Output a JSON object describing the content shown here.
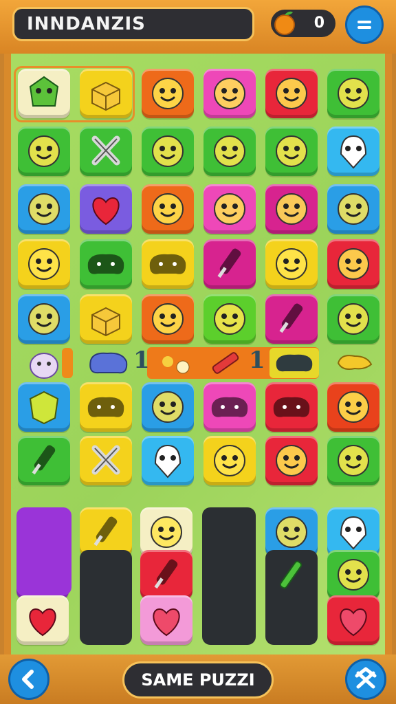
{
  "header": {
    "title": "INNDANZIS",
    "score": "0"
  },
  "footer": {
    "button_label": "SAME PUZZI"
  },
  "strip": {
    "num_left": "1",
    "num_right": "1"
  },
  "colors": {
    "accent": "#e88d2a",
    "board": "#a8dc62",
    "button_blue": "#1e8fe0"
  },
  "tiles": [
    {
      "row": 0,
      "col": 0,
      "color": "cream",
      "icon": "green-gem-icon"
    },
    {
      "row": 0,
      "col": 1,
      "color": "yellow",
      "icon": "box-icon"
    },
    {
      "row": 0,
      "col": 2,
      "color": "orange",
      "icon": "cat-face-icon"
    },
    {
      "row": 0,
      "col": 3,
      "color": "pink",
      "icon": "chick-face-icon"
    },
    {
      "row": 0,
      "col": 4,
      "color": "red",
      "icon": "spiky-blob-icon"
    },
    {
      "row": 0,
      "col": 5,
      "color": "green",
      "icon": "smiley-face-icon"
    },
    {
      "row": 1,
      "col": 0,
      "color": "green",
      "icon": "smiley-face-icon"
    },
    {
      "row": 1,
      "col": 1,
      "color": "green",
      "icon": "cross-icon"
    },
    {
      "row": 1,
      "col": 2,
      "color": "green",
      "icon": "smiley-face-icon"
    },
    {
      "row": 1,
      "col": 3,
      "color": "green",
      "icon": "smiley-face-icon"
    },
    {
      "row": 1,
      "col": 4,
      "color": "green",
      "icon": "fox-face-icon"
    },
    {
      "row": 1,
      "col": 5,
      "color": "sky",
      "icon": "ghost-face-icon"
    },
    {
      "row": 2,
      "col": 0,
      "color": "blue",
      "icon": "fox-face-icon"
    },
    {
      "row": 2,
      "col": 1,
      "color": "purple",
      "icon": "heart-drop-icon"
    },
    {
      "row": 2,
      "col": 2,
      "color": "orange",
      "icon": "cat-face-icon"
    },
    {
      "row": 2,
      "col": 3,
      "color": "pink",
      "icon": "slime-face-icon"
    },
    {
      "row": 2,
      "col": 4,
      "color": "magenta",
      "icon": "frog-face-icon"
    },
    {
      "row": 2,
      "col": 5,
      "color": "blue",
      "icon": "bunny-face-icon"
    },
    {
      "row": 3,
      "col": 0,
      "color": "yellow",
      "icon": "hamster-face-icon"
    },
    {
      "row": 3,
      "col": 1,
      "color": "green",
      "icon": "gamepad-icon"
    },
    {
      "row": 3,
      "col": 2,
      "color": "yellow",
      "icon": "gamepad-icon"
    },
    {
      "row": 3,
      "col": 3,
      "color": "magenta",
      "icon": "popsicle-icon"
    },
    {
      "row": 3,
      "col": 4,
      "color": "yellow",
      "icon": "blob-face-icon"
    },
    {
      "row": 3,
      "col": 5,
      "color": "red",
      "icon": "peach-face-icon"
    },
    {
      "row": 4,
      "col": 0,
      "color": "blue",
      "icon": "cat-face-icon"
    },
    {
      "row": 4,
      "col": 1,
      "color": "yellow",
      "icon": "box-icon"
    },
    {
      "row": 4,
      "col": 2,
      "color": "orange",
      "icon": "fish-face-icon"
    },
    {
      "row": 4,
      "col": 3,
      "color": "lime",
      "icon": "slime-face-icon"
    },
    {
      "row": 4,
      "col": 4,
      "color": "magenta",
      "icon": "popsicle-icon"
    },
    {
      "row": 4,
      "col": 5,
      "color": "green",
      "icon": "fox-face-icon"
    },
    {
      "row": 6,
      "col": 0,
      "color": "blue",
      "icon": "shield-icon"
    },
    {
      "row": 6,
      "col": 1,
      "color": "yellow",
      "icon": "gamepad-icon"
    },
    {
      "row": 6,
      "col": 2,
      "color": "blue",
      "icon": "fox-face-icon"
    },
    {
      "row": 6,
      "col": 3,
      "color": "pink",
      "icon": "gamepad-icon"
    },
    {
      "row": 6,
      "col": 4,
      "color": "red",
      "icon": "gamepad-icon"
    },
    {
      "row": 6,
      "col": 5,
      "color": "redorange",
      "icon": "apple-face-icon"
    },
    {
      "row": 7,
      "col": 0,
      "color": "green",
      "icon": "marker-icon"
    },
    {
      "row": 7,
      "col": 1,
      "color": "yellow",
      "icon": "cross-icon"
    },
    {
      "row": 7,
      "col": 2,
      "color": "sky",
      "icon": "ghost-face-icon"
    },
    {
      "row": 7,
      "col": 3,
      "color": "yellow",
      "icon": "smiley-face-icon"
    },
    {
      "row": 7,
      "col": 4,
      "color": "red",
      "icon": "smiley-face-icon"
    },
    {
      "row": 7,
      "col": 5,
      "color": "green",
      "icon": "smiley-face-icon"
    }
  ],
  "lower_tiles": [
    {
      "slot": "a1",
      "color": "violet",
      "icon": "cat-face-icon"
    },
    {
      "slot": "a2",
      "color": "violet",
      "icon": "apple-face-icon"
    },
    {
      "slot": "a3",
      "color": "cream",
      "icon": "apple-icon"
    },
    {
      "slot": "b1",
      "color": "yellow",
      "icon": "brush-icon"
    },
    {
      "slot": "c1",
      "color": "cream",
      "icon": "bird-icon"
    },
    {
      "slot": "c2",
      "color": "red",
      "icon": "racket-icon"
    },
    {
      "slot": "c3",
      "color": "lpink",
      "icon": "heart-icon"
    },
    {
      "slot": "e1",
      "color": "blue",
      "icon": "smiley-face-icon"
    },
    {
      "slot": "f1",
      "color": "sky",
      "icon": "ghost-face-icon"
    },
    {
      "slot": "f2",
      "color": "green",
      "icon": "dog-icon"
    },
    {
      "slot": "f3",
      "color": "red",
      "icon": "heart-icon"
    }
  ]
}
